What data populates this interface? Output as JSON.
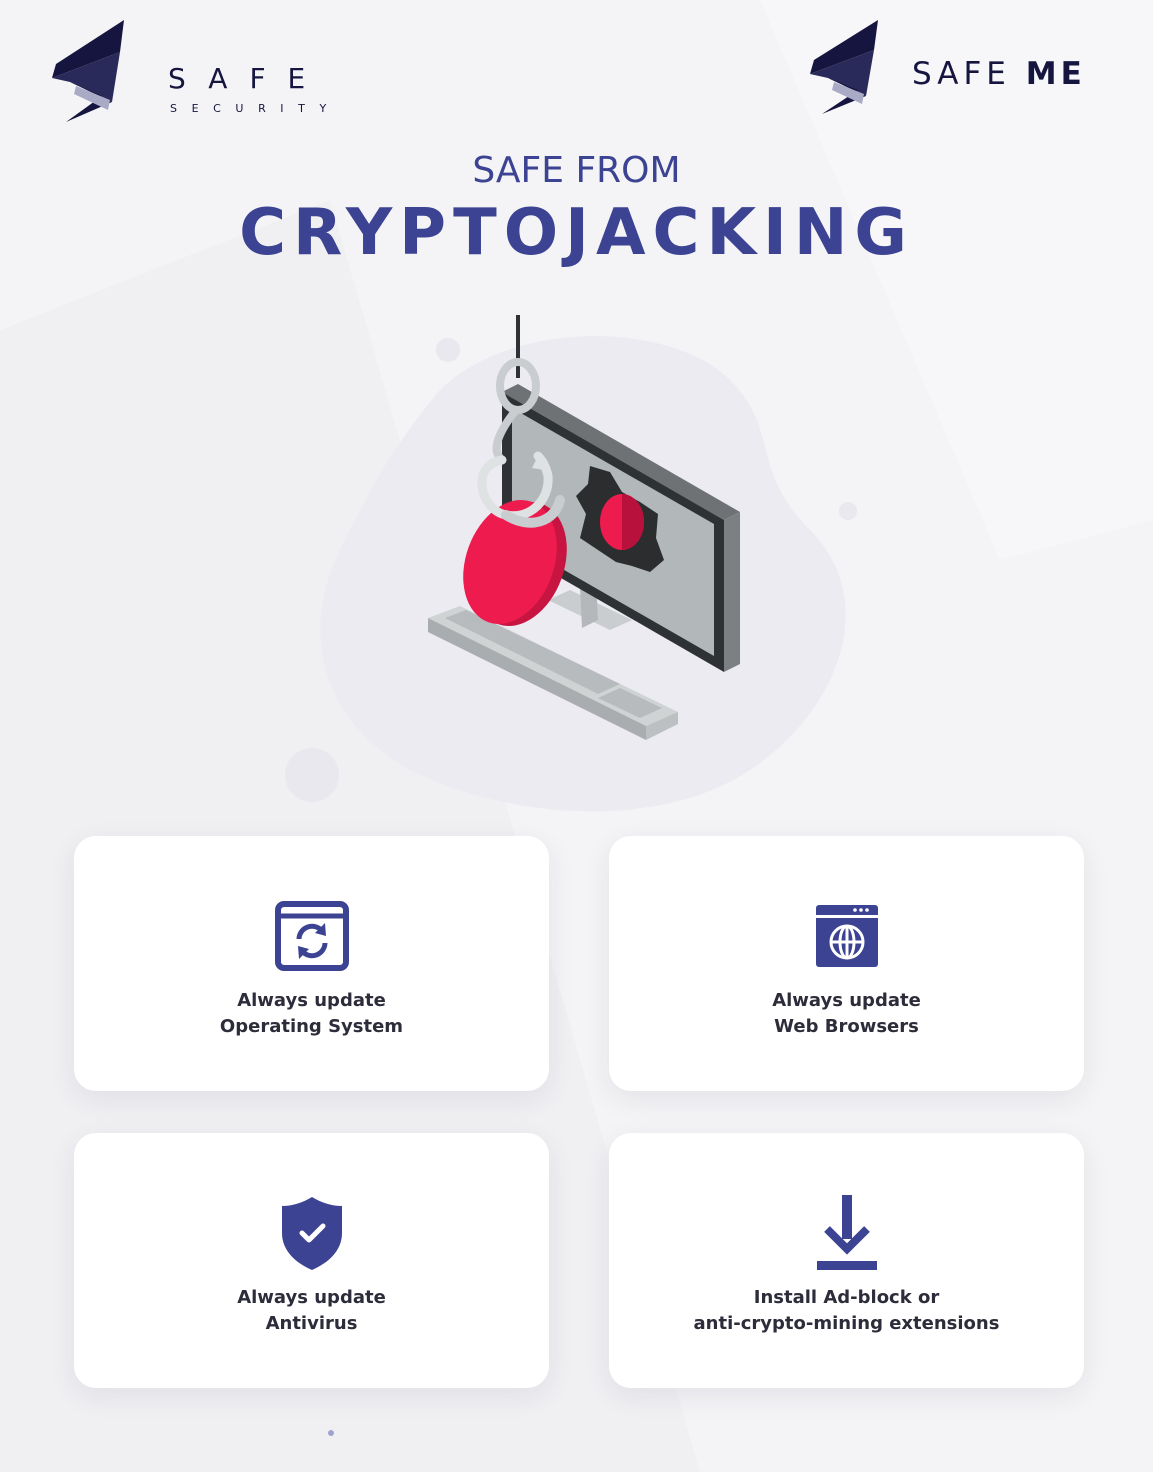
{
  "header": {
    "left_logo": {
      "icon": "safe-s-logo-icon",
      "word": "SAFE",
      "sub": "SECURITY"
    },
    "right_logo": {
      "icon": "safe-s-logo-icon",
      "word_light": "SAFE",
      "word_bold": "ME"
    }
  },
  "title": {
    "line1": "SAFE FROM",
    "line2": "CRYPTOJACKING"
  },
  "illustration": {
    "icon": "hooked-coin-monitor-illustration"
  },
  "cards": [
    {
      "icon": "window-refresh-icon",
      "line1": "Always update",
      "line2": "Operating System"
    },
    {
      "icon": "browser-globe-icon",
      "line1": "Always update",
      "line2": "Web Browsers"
    },
    {
      "icon": "shield-check-icon",
      "line1": "Always update",
      "line2": "Antivirus"
    },
    {
      "icon": "download-icon",
      "line1": "Install Ad-block or",
      "line2": "anti-crypto-mining extensions"
    }
  ],
  "colors": {
    "brand_navy": "#15153f",
    "accent_indigo": "#3b4392",
    "coin_red": "#ee1c4e",
    "background": "#f4f4f6"
  }
}
